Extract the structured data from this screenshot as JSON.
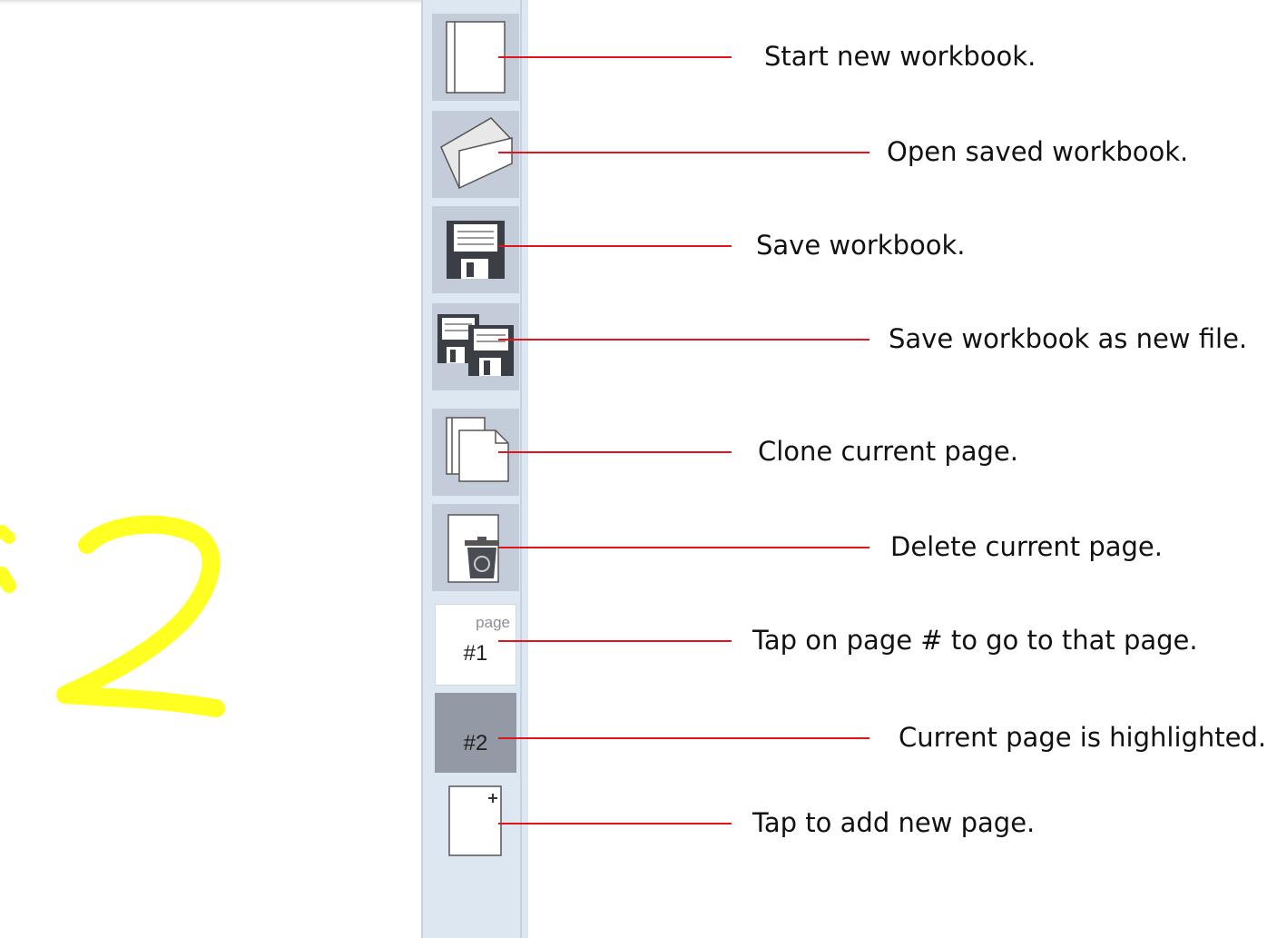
{
  "canvas": {
    "ink_color": "#ffff22",
    "visible_glyph": "2"
  },
  "toolbar": {
    "tools": [
      {
        "name": "new-workbook",
        "icon": "blank-page-icon"
      },
      {
        "name": "open-workbook",
        "icon": "open-folder-icon"
      },
      {
        "name": "save-workbook",
        "icon": "floppy-disk-icon"
      },
      {
        "name": "save-as",
        "icon": "double-floppy-disk-icon"
      },
      {
        "name": "clone-page",
        "icon": "duplicate-pages-icon"
      },
      {
        "name": "delete-page",
        "icon": "page-trash-icon"
      }
    ],
    "pages": [
      {
        "caption": "page",
        "number": "#1",
        "current": false
      },
      {
        "caption": "",
        "number": "#2",
        "current": true
      }
    ],
    "add_page_icon": "add-page-plus-icon"
  },
  "annotations": [
    {
      "text": "Start new workbook."
    },
    {
      "text": "Open saved workbook."
    },
    {
      "text": "Save workbook."
    },
    {
      "text": "Save workbook as new file."
    },
    {
      "text": "Clone current page."
    },
    {
      "text": "Delete current page."
    },
    {
      "text": "Tap on page # to go to that page."
    },
    {
      "text": "Current page is highlighted."
    },
    {
      "text": "Tap to add new page."
    }
  ],
  "colors": {
    "leader_line": "#e0141b",
    "toolbar_bg": "#dde7f2",
    "tool_bg": "#c3ccd8",
    "current_page_bg": "#939aa5"
  }
}
